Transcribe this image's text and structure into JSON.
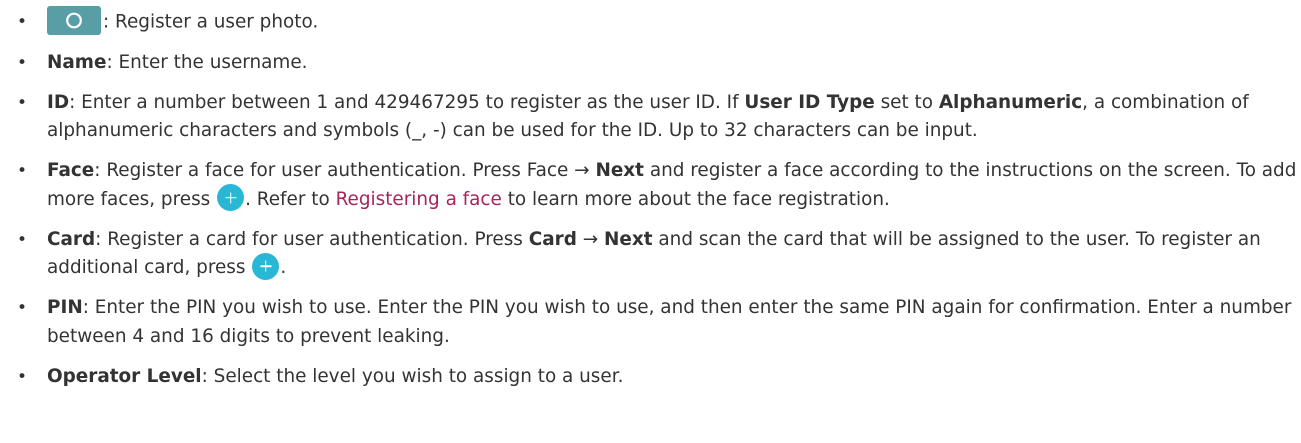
{
  "items": {
    "photo": {
      "text": ": Register a user photo."
    },
    "name": {
      "term": "Name",
      "text": ": Enter the username."
    },
    "id": {
      "term": "ID",
      "text1": ": Enter a number between 1 and 429467295 to register as the user ID. If ",
      "term2": "User ID Type",
      "text2": " set to ",
      "term3": "Alphanumeric",
      "text3": ", a combination of alphanumeric characters and symbols (_, -) can be used for the ID. Up to 32 characters can be input."
    },
    "face": {
      "term": "Face",
      "text1": ": Register a face for user authentication. Press Face → ",
      "term2": "Next",
      "text2": " and register a face according to the instructions on the screen. To add more faces, press ",
      "text3": ". Refer to ",
      "link": "Registering a face",
      "text4": " to learn more about the face registration."
    },
    "card": {
      "term": "Card",
      "text1": ": Register a card for user authentication. Press ",
      "term2": "Card",
      "text2": " → ",
      "term3": "Next",
      "text3": " and scan the card that will be assigned to the user. To register an additional card, press ",
      "text4": "."
    },
    "pin": {
      "term": "PIN",
      "text": ": Enter the PIN you wish to use. Enter the PIN you wish to use, and then enter the same PIN again for confirmation. Enter a number between 4 and 16 digits to prevent leaking."
    },
    "operator": {
      "term": "Operator Level",
      "text": ": Select the level you wish to assign to a user."
    }
  },
  "bullet_char": "•",
  "colors": {
    "text": "#333333",
    "link": "#a5255a",
    "camera_button": "#5a9ea5",
    "plus_icon": "#2ab7d6"
  },
  "icons": {
    "camera": "camera-icon",
    "plus": "plus-circle-icon"
  }
}
